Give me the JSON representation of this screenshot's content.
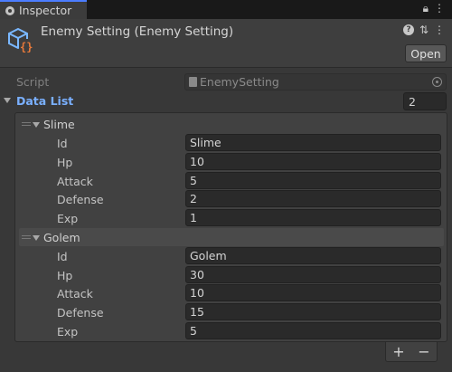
{
  "tab": {
    "title": "Inspector",
    "lock_icon": "lock-icon",
    "menu_icon": "kebab-menu-icon"
  },
  "header": {
    "title": "Enemy Setting (Enemy Setting)",
    "open_label": "Open",
    "help_icon": "help-icon",
    "settings_icon": "preset-sliders-icon",
    "menu_icon": "kebab-menu-icon"
  },
  "script": {
    "label": "Script",
    "value": "EnemySetting"
  },
  "data_list": {
    "label": "Data List",
    "count": "2",
    "elements": [
      {
        "name": "Slime",
        "props": [
          {
            "label": "Id",
            "value": "Slime"
          },
          {
            "label": "Hp",
            "value": "10"
          },
          {
            "label": "Attack",
            "value": "5"
          },
          {
            "label": "Defense",
            "value": "2"
          },
          {
            "label": "Exp",
            "value": "1"
          }
        ]
      },
      {
        "name": "Golem",
        "props": [
          {
            "label": "Id",
            "value": "Golem"
          },
          {
            "label": "Hp",
            "value": "30"
          },
          {
            "label": "Attack",
            "value": "10"
          },
          {
            "label": "Defense",
            "value": "15"
          },
          {
            "label": "Exp",
            "value": "5"
          }
        ]
      }
    ],
    "add_label": "+",
    "remove_label": "−"
  },
  "colors": {
    "accent": "#4c7dff",
    "label_blue": "#7ab0ff",
    "script_icon_orange": "#e8793a",
    "script_icon_blue": "#7ab8ff"
  }
}
